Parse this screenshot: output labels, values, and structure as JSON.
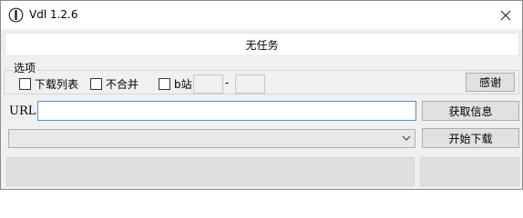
{
  "window": {
    "title": "Vdl 1.2.6"
  },
  "status": {
    "text": "无任务"
  },
  "options": {
    "legend": "选项",
    "download_list": "下载列表",
    "no_merge": "不合并",
    "bilibili": "b站",
    "range_separator": "-",
    "thanks_button": "感谢"
  },
  "url": {
    "label": "URL",
    "value": "",
    "fetch_button": "获取信息"
  },
  "download": {
    "start_button": "开始下载",
    "format_selected": ""
  },
  "icons": {
    "app": "app-logo-icon",
    "close": "close-icon",
    "dropdown": "chevron-down-icon"
  }
}
